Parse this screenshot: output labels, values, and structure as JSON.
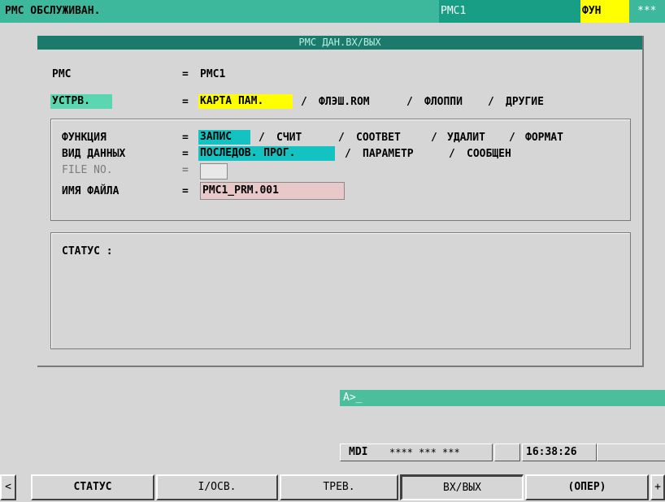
{
  "header": {
    "title": "PMC ОБСЛУЖИВАН.",
    "program": "PMC1",
    "mode": "ФУН",
    "alarm": "***"
  },
  "panel": {
    "title": "PMC ДАН.ВХ/ВЫХ",
    "pmc_label": "PMC",
    "pmc_value": "PMC1",
    "device_label": "УСТРВ.",
    "device_options": [
      "КАРТА ПАМ.",
      "ФЛЭШ.ROM",
      "ФЛОППИ",
      "ДРУГИЕ"
    ],
    "function_label": "ФУНКЦИЯ",
    "function_options": [
      "ЗАПИС",
      "СЧИТ",
      "СООТВЕТ",
      "УДАЛИТ",
      "ФОРМАТ"
    ],
    "data_kind_label": "ВИД ДАННЫХ",
    "data_kind_options": [
      "ПОСЛЕДОВ. ПРОГ.",
      "ПАРАМЕТР",
      "СООБЩЕН"
    ],
    "file_no_label": "FILE NO.",
    "file_no_value": "",
    "file_name_label": "ИМЯ ФАЙЛА",
    "file_name_value": "PMC1_PRM.001",
    "status_label": "СТАТУС :",
    "eq": "=",
    "sep": "/"
  },
  "cmdline": {
    "prompt": "A>_"
  },
  "statusbar": {
    "mode": "MDI",
    "stars": "**** *** ***",
    "time": "16:38:26"
  },
  "softkeys": {
    "left_arrow": "<",
    "right_arrow": "+",
    "keys": [
      "СТАТУС",
      "I/ОСВ.",
      "ТРЕВ.",
      "ВХ/ВЫХ",
      "(ОПЕР)"
    ]
  },
  "colors": {
    "header_bg": "#3db89d",
    "panel_title_bg": "#1a7a6c",
    "selected_teal": "#14c2c2",
    "selected_yellow": "#ffff00",
    "file_name_bg": "#e8c8c8"
  }
}
